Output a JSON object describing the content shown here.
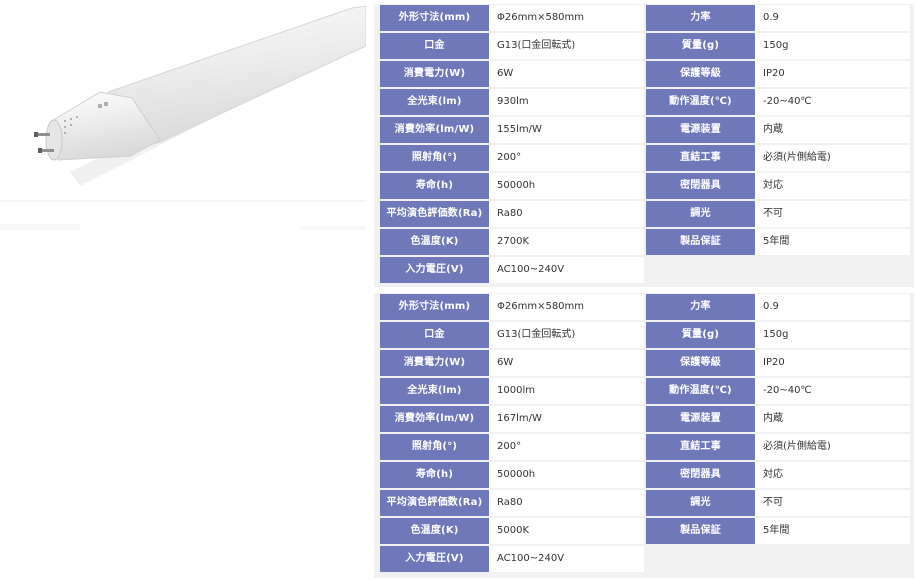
{
  "colors": {
    "label_background": "#6f79ba",
    "label_text": "#ffffff",
    "value_background": "#ffffff",
    "panel_background": "#f1f1f1"
  },
  "product_image": {
    "alt": "LED straight tube lamp",
    "cap_marking": "G13"
  },
  "spec_tables": [
    {
      "rows": [
        {
          "label": "外形寸法(mm)",
          "value": "Φ26mm×580mm",
          "label2": "力率",
          "value2": "0.9"
        },
        {
          "label": "口金",
          "value": "G13(口金回転式)",
          "label2": "質量(g)",
          "value2": "150g"
        },
        {
          "label": "消費電力(W)",
          "value": "6W",
          "label2": "保護等級",
          "value2": "IP20"
        },
        {
          "label": "全光束(lm)",
          "value": "930lm",
          "label2": "動作温度(℃)",
          "value2": "-20~40℃"
        },
        {
          "label": "消費効率(lm/W)",
          "value": "155lm/W",
          "label2": "電源装置",
          "value2": "内蔵"
        },
        {
          "label": "照射角(°)",
          "value": "200°",
          "label2": "直結工事",
          "value2": "必須(片側給電)"
        },
        {
          "label": "寿命(h)",
          "value": "50000h",
          "label2": "密閉器具",
          "value2": "対応"
        },
        {
          "label": "平均演色評価数(Ra)",
          "value": "Ra80",
          "label2": "調光",
          "value2": "不可"
        },
        {
          "label": "色温度(K)",
          "value": "2700K",
          "label2": "製品保証",
          "value2": "5年間"
        },
        {
          "label": "入力電圧(V)",
          "value": "AC100~240V"
        }
      ]
    },
    {
      "rows": [
        {
          "label": "外形寸法(mm)",
          "value": "Φ26mm×580mm",
          "label2": "力率",
          "value2": "0.9"
        },
        {
          "label": "口金",
          "value": "G13(口金回転式)",
          "label2": "質量(g)",
          "value2": "150g"
        },
        {
          "label": "消費電力(W)",
          "value": "6W",
          "label2": "保護等級",
          "value2": "IP20"
        },
        {
          "label": "全光束(lm)",
          "value": "1000lm",
          "label2": "動作温度(℃)",
          "value2": "-20~40℃"
        },
        {
          "label": "消費効率(lm/W)",
          "value": "167lm/W",
          "label2": "電源装置",
          "value2": "内蔵"
        },
        {
          "label": "照射角(°)",
          "value": "200°",
          "label2": "直結工事",
          "value2": "必須(片側給電)"
        },
        {
          "label": "寿命(h)",
          "value": "50000h",
          "label2": "密閉器具",
          "value2": "対応"
        },
        {
          "label": "平均演色評価数(Ra)",
          "value": "Ra80",
          "label2": "調光",
          "value2": "不可"
        },
        {
          "label": "色温度(K)",
          "value": "5000K",
          "label2": "製品保証",
          "value2": "5年間"
        },
        {
          "label": "入力電圧(V)",
          "value": "AC100~240V"
        }
      ]
    }
  ]
}
